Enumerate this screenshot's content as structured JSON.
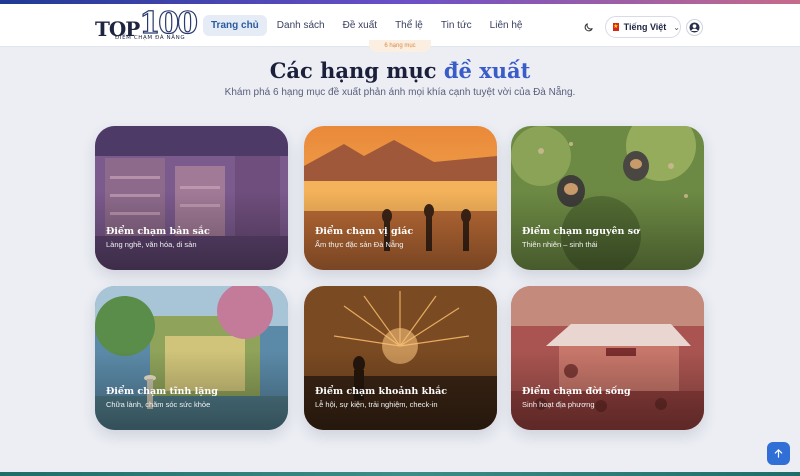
{
  "header": {
    "logo": {
      "top": "TOP",
      "hundred": "100",
      "tagline": "ĐIỂM CHẠM ĐÀ NẴNG"
    },
    "nav": [
      {
        "label": "Trang chủ",
        "active": true
      },
      {
        "label": "Danh sách",
        "active": false
      },
      {
        "label": "Đề xuất",
        "active": false
      },
      {
        "label": "Thể lệ",
        "active": false
      },
      {
        "label": "Tin tức",
        "active": false
      },
      {
        "label": "Liên hệ",
        "active": false
      }
    ],
    "language": {
      "label": "Tiếng Việt",
      "flag_color": "#da251d"
    },
    "icons": {
      "theme": "moon-icon",
      "user": "user-icon"
    }
  },
  "section": {
    "eyebrow": "6 hạng mục",
    "title_main": "Các hạng mục ",
    "title_accent": "đề xuất",
    "subtitle": "Khám phá 6 hạng mục đề xuất phản ánh mọi khía cạnh tuyệt vời của Đà Nẵng."
  },
  "categories": [
    {
      "title": "Điểm chạm bản sắc",
      "desc": "Làng nghề, văn hóa, di sản",
      "color": "#7a4fb0"
    },
    {
      "title": "Điểm chạm vị giác",
      "desc": "Ẩm thực đặc sản Đà Nẵng",
      "color": "#e07a2a"
    },
    {
      "title": "Điểm chạm nguyên sơ",
      "desc": "Thiên nhiên – sinh thái",
      "color": "#4f7a35"
    },
    {
      "title": "Điểm chạm tĩnh lặng",
      "desc": "Chữa lành, chăm sóc sức khỏe",
      "color": "#3f7fa6"
    },
    {
      "title": "Điểm chạm khoảnh khắc",
      "desc": "Lễ hội, sự kiện, trải nghiệm, check-in",
      "color": "#a4541f"
    },
    {
      "title": "Điểm chạm đời sống",
      "desc": "Sinh hoạt địa phương",
      "color": "#b0404a"
    }
  ],
  "colors": {
    "accent": "#3a5cc9",
    "nav_active": "#2c5aa0",
    "back_to_top": "#2f6fd6"
  }
}
